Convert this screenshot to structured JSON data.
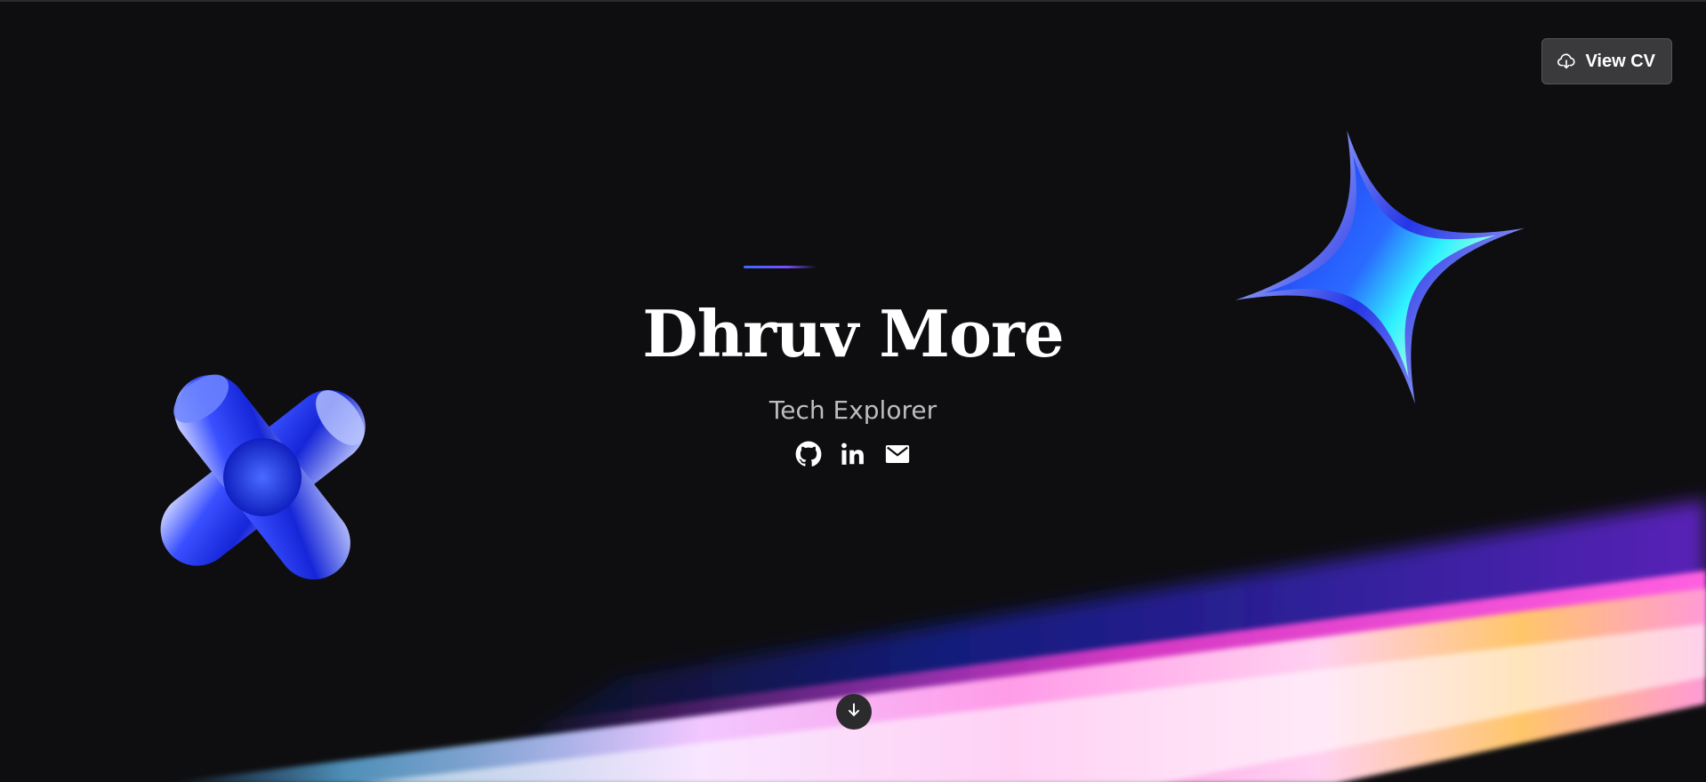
{
  "header": {
    "cv_label": "View CV",
    "cv_icon": "cloud-download-icon"
  },
  "hero": {
    "name": "Dhruv More",
    "subtitle": "Tech Explorer",
    "socials": [
      {
        "name": "github",
        "icon": "github-icon"
      },
      {
        "name": "linkedin",
        "icon": "linkedin-icon"
      },
      {
        "name": "email",
        "icon": "mail-icon"
      }
    ],
    "scroll_icon": "arrow-down-icon"
  },
  "colors": {
    "background": "#0e0e10",
    "accent_blue": "#2a3bff",
    "button_bg": "#3a3a3c",
    "subtitle": "#bdbdbd"
  }
}
